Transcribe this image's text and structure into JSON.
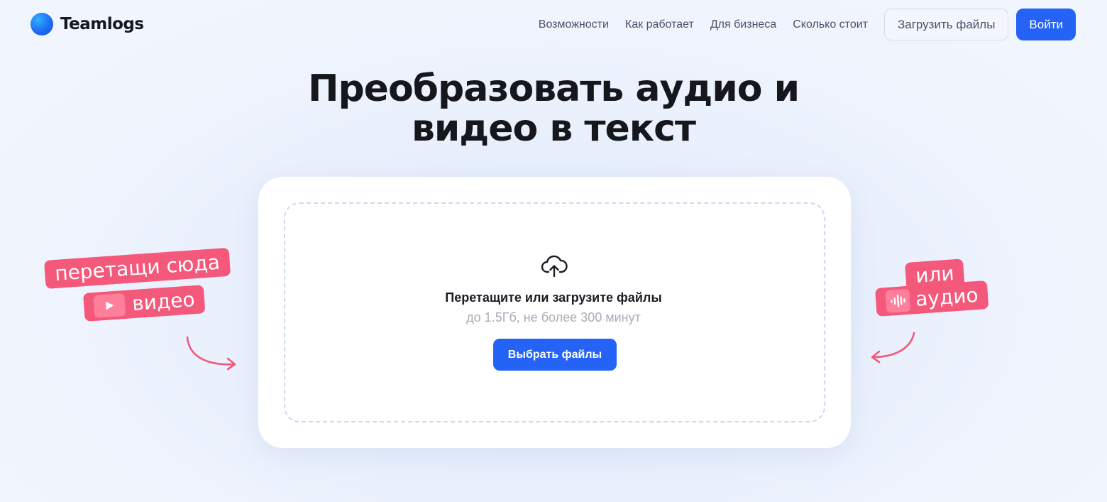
{
  "header": {
    "logo_text": "Teamlogs",
    "nav": [
      "Возможности",
      "Как работает",
      "Для бизнеса",
      "Сколько стоит"
    ],
    "upload_label": "Загрузить файлы",
    "login_label": "Войти"
  },
  "hero": {
    "title_line1": "Преобразовать аудио и",
    "title_line2": "видео в текст"
  },
  "dropzone": {
    "title": "Перетащите или загрузите файлы",
    "subtitle": "до 1.5Гб, не более 300 минут",
    "button_label": "Выбрать файлы"
  },
  "stickers": {
    "left_line1": "перетащи сюда",
    "left_line2": "видео",
    "right_line1": "или",
    "right_line2": "аудио"
  },
  "colors": {
    "accent": "#2563f6",
    "sticker": "#f4587a"
  }
}
